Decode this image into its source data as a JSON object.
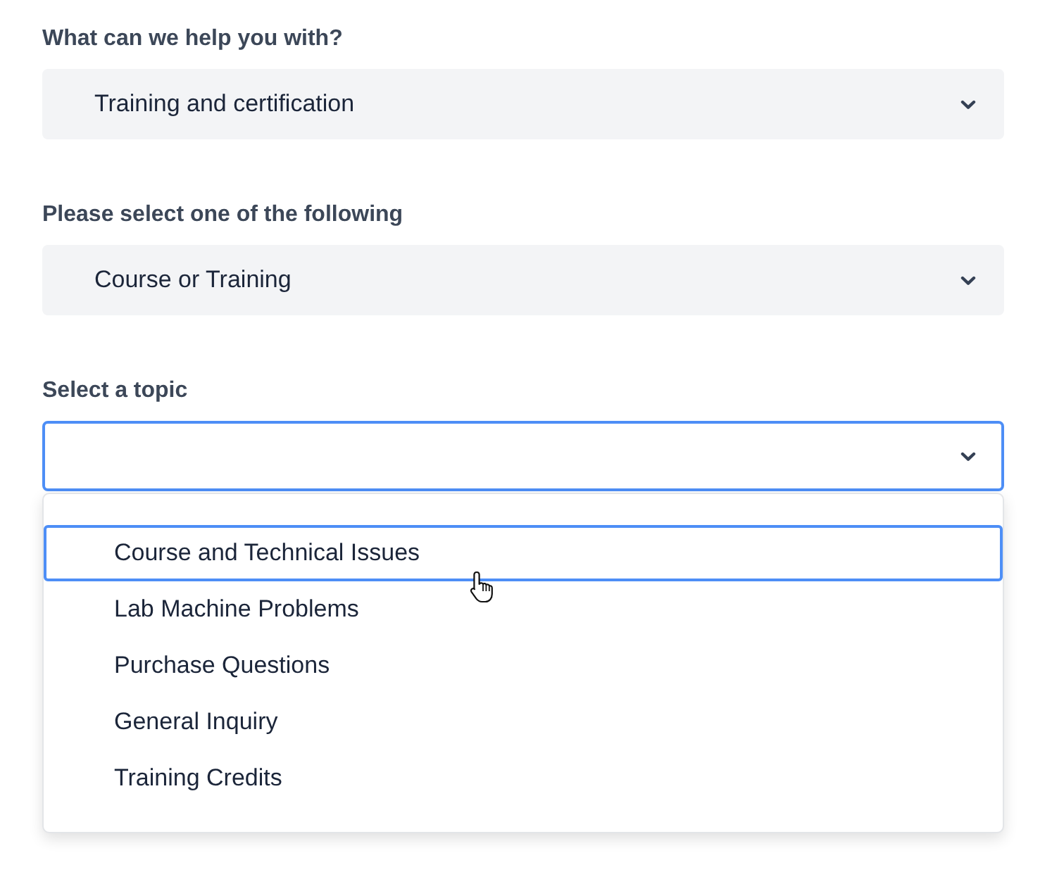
{
  "fields": [
    {
      "label": "What can we help you with?",
      "value": "Training and certification",
      "expanded": false
    },
    {
      "label": "Please select one of the following",
      "value": "Course or Training",
      "expanded": false
    },
    {
      "label": "Select a topic",
      "expanded": true,
      "options": [
        {
          "label": "Course and Technical Issues",
          "selected": true
        },
        {
          "label": "Lab Machine Problems",
          "selected": false
        },
        {
          "label": "Purchase Questions",
          "selected": false
        },
        {
          "label": "General Inquiry",
          "selected": false
        },
        {
          "label": "Training Credits",
          "selected": false
        }
      ]
    }
  ]
}
